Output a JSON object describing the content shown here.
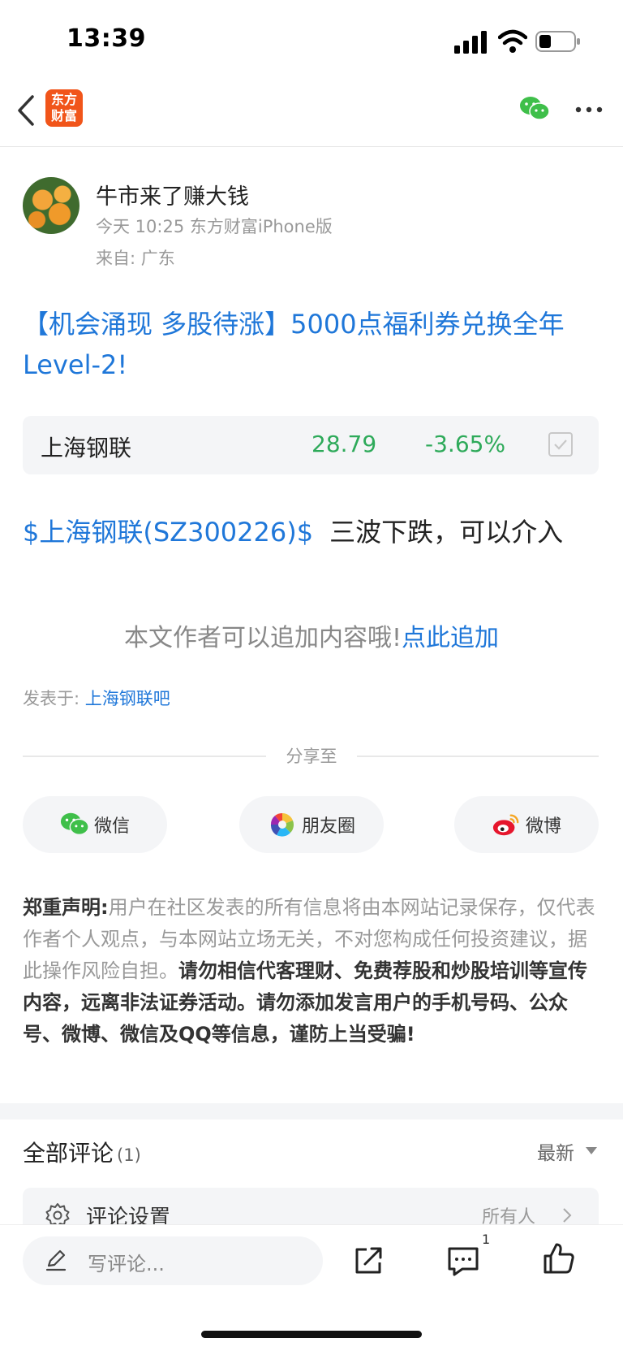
{
  "status_bar": {
    "time": "13:39"
  },
  "header": {
    "logo_line1": "东方",
    "logo_line2": "财富"
  },
  "author": {
    "name": "牛市来了赚大钱",
    "meta": "今天 10:25 东方财富iPhone版",
    "from": "来自: 广东"
  },
  "post": {
    "title": "【机会涌现 多股待涨】5000点福利券兑换全年Level-2!",
    "stock_card": {
      "name": "上海钢联",
      "price": "28.79",
      "change": "-3.65%"
    },
    "stock_link": "$上海钢联(SZ300226)$",
    "body": "三波下跌，可以介入",
    "append_tip": "本文作者可以追加内容哦!",
    "append_link": "点此追加",
    "posted_in_label": "发表于:",
    "posted_in_bar": "上海钢联吧"
  },
  "share": {
    "label": "分享至",
    "wechat": "微信",
    "moments": "朋友圈",
    "weibo": "微博"
  },
  "disclaimer": {
    "title": "郑重声明:",
    "text": "用户在社区发表的所有信息将由本网站记录保存，仅代表作者个人观点，与本网站立场无关，不对您构成任何投资建议，据此操作风险自担。",
    "warning": "请勿相信代客理财、免费荐股和炒股培训等宣传内容，远离非法证券活动。请勿添加发言用户的手机号码、公众号、微博、微信及QQ等信息，谨防上当受骗!"
  },
  "comments": {
    "title": "全部评论",
    "count": "(1)",
    "sort": "最新",
    "settings_label": "评论设置",
    "settings_value": "所有人"
  },
  "bottom_bar": {
    "placeholder": "写评论...",
    "message_count": "1"
  },
  "colors": {
    "link": "#1f77d9",
    "down": "#2eaa5a",
    "logo": "#f1551a"
  }
}
